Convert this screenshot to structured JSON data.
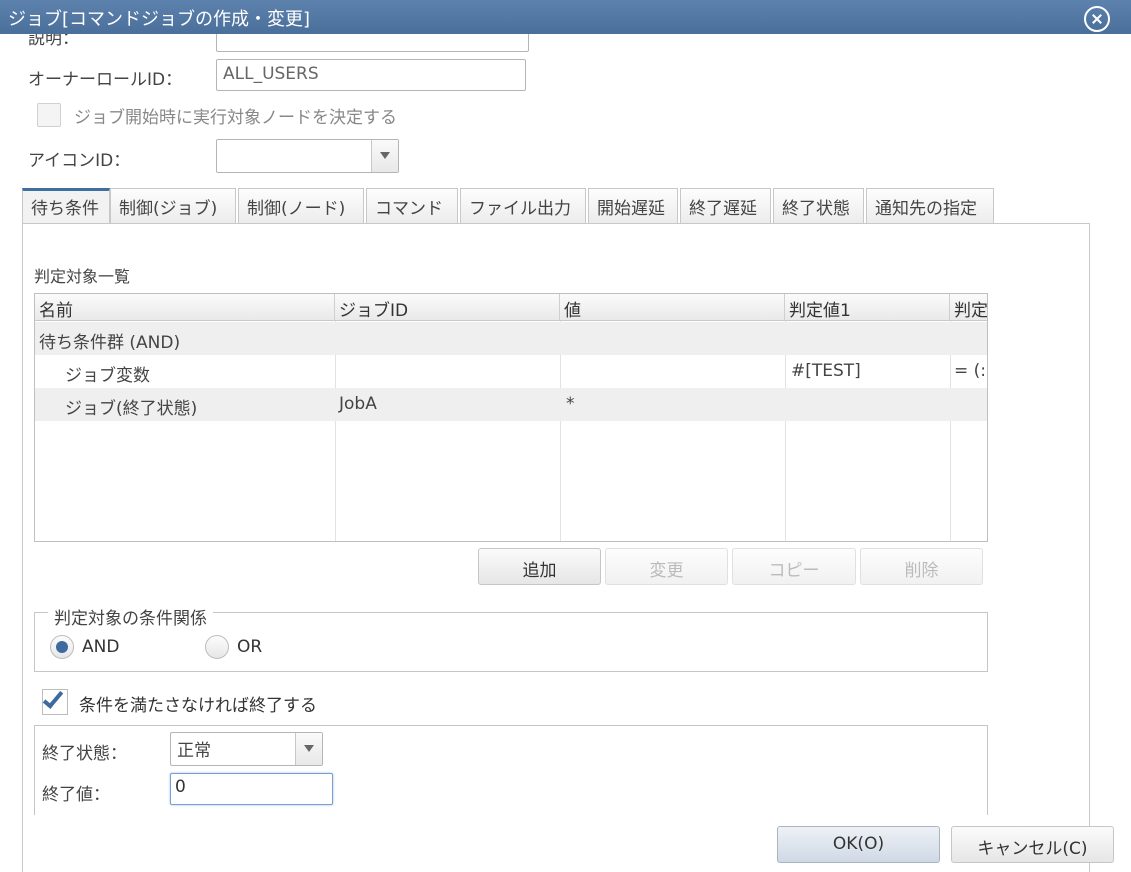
{
  "window": {
    "title": "ジョブ[コマンドジョブの作成・変更]"
  },
  "form": {
    "description_label": "説明：",
    "owner_role_label": "オーナーロールID：",
    "owner_role_value": "ALL_USERS",
    "decide_node_label": "ジョブ開始時に実行対象ノードを決定する",
    "icon_id_label": "アイコンID："
  },
  "tabs": [
    {
      "label": "待ち条件"
    },
    {
      "label": "制御(ジョブ)"
    },
    {
      "label": "制御(ノード)"
    },
    {
      "label": "コマンド"
    },
    {
      "label": "ファイル出力"
    },
    {
      "label": "開始遅延"
    },
    {
      "label": "終了遅延"
    },
    {
      "label": "終了状態"
    },
    {
      "label": "通知先の指定"
    }
  ],
  "wait": {
    "list_title": "判定対象一覧",
    "columns": [
      "名前",
      "ジョブID",
      "値",
      "判定値1",
      "判定"
    ],
    "rows": [
      {
        "name": "待ち条件群 (AND)",
        "job_id": "",
        "value": "",
        "judge1": "",
        "judge2": ""
      },
      {
        "name": "ジョブ変数",
        "job_id": "",
        "value": "",
        "judge1": "#[TEST]",
        "judge2": "= (:"
      },
      {
        "name": "ジョブ(終了状態)",
        "job_id": "JobA",
        "value": "*",
        "judge1": "",
        "judge2": ""
      }
    ],
    "buttons": {
      "add": "追加",
      "modify": "変更",
      "copy": "コピー",
      "delete": "削除"
    },
    "relation_legend": "判定対象の条件関係",
    "and_label": "AND",
    "or_label": "OR",
    "end_if_unmet_label": "条件を満たさなければ終了する",
    "end_status_label": "終了状態：",
    "end_status_value": "正常",
    "end_value_label": "終了値：",
    "end_value": "0"
  },
  "footer": {
    "ok": "OK(O)",
    "cancel": "キャンセル(C)"
  }
}
